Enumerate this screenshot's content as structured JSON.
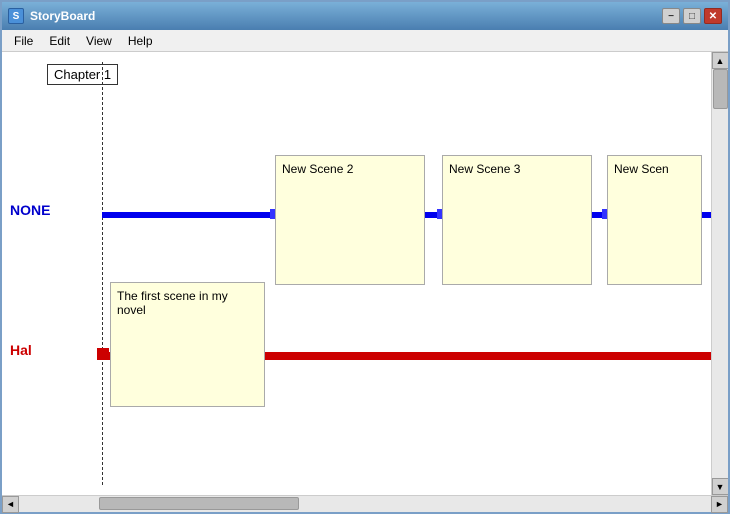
{
  "window": {
    "title": "StoryBoard",
    "minimize_label": "−",
    "maximize_label": "□",
    "close_label": "✕"
  },
  "menu": {
    "items": [
      "File",
      "Edit",
      "View",
      "Help"
    ]
  },
  "canvas": {
    "chapter_label": "Chapter 1",
    "none_label": "NONE",
    "hal_label": "Hal",
    "scene2_label": "New Scene 2",
    "scene3_label": "New Scene 3",
    "scene4_label": "New Scen",
    "hal_scene_text": "The first scene in my novel"
  },
  "scrollbars": {
    "up_arrow": "▲",
    "down_arrow": "▼",
    "left_arrow": "◄",
    "right_arrow": "►"
  }
}
